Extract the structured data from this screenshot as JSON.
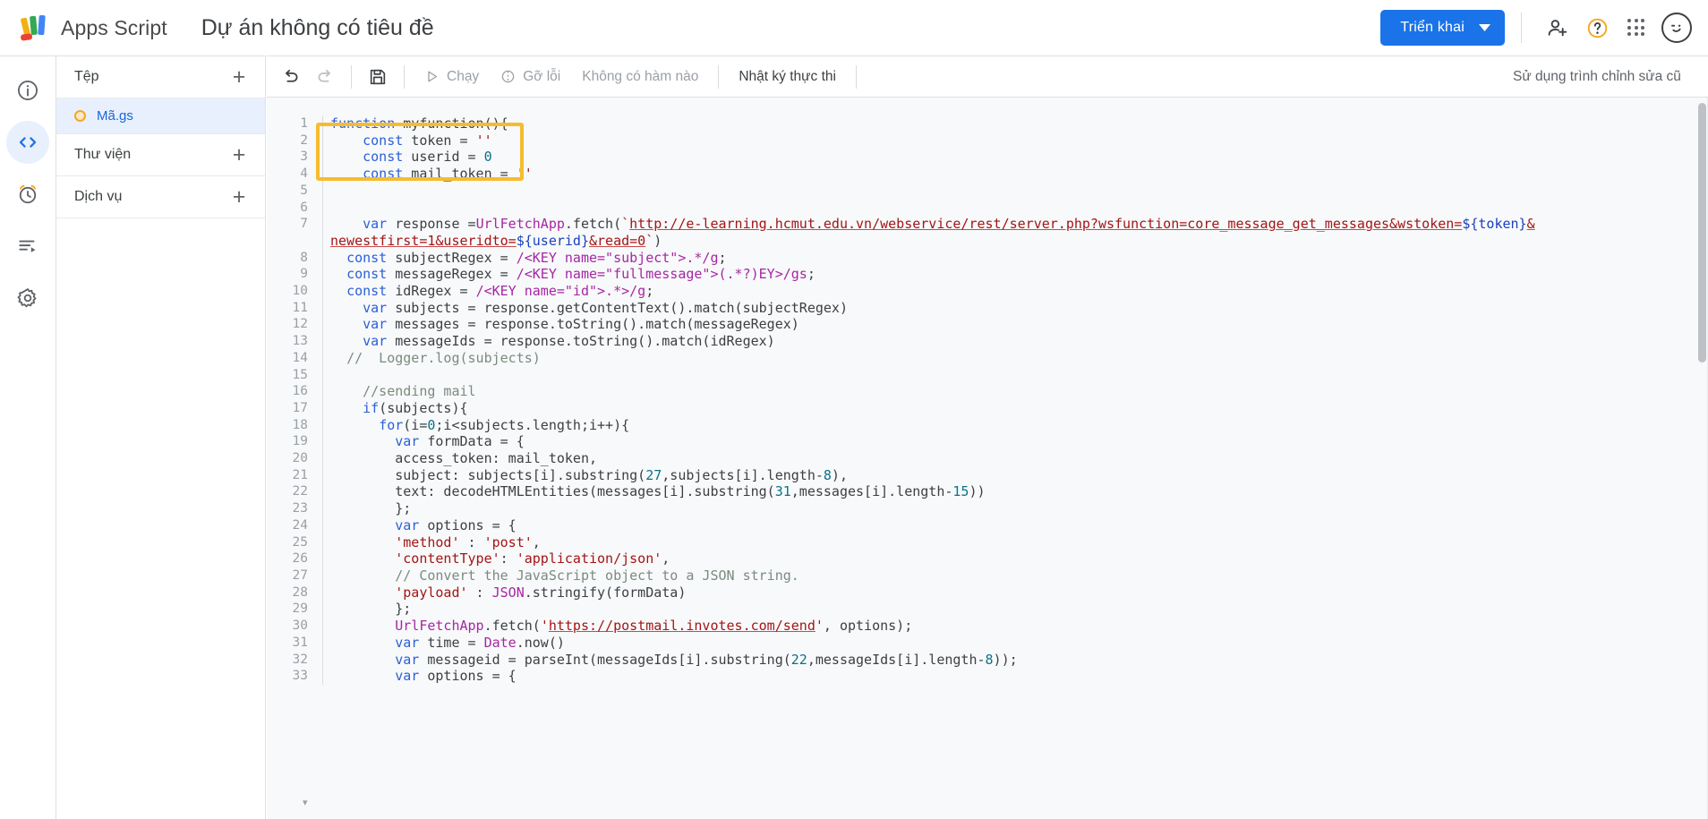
{
  "header": {
    "app_title": "Apps Script",
    "project_title": "Dự án không có tiêu đề",
    "deploy_label": "Triển khai",
    "icons": {
      "add_person": "add-person-icon",
      "help": "help-icon",
      "apps_grid": "apps-grid-icon",
      "avatar": "avatar-wink-icon"
    },
    "brand_color": "#1a73e8"
  },
  "rail": {
    "items": [
      {
        "name": "overview",
        "icon": "info-circle-icon",
        "active": false
      },
      {
        "name": "editor",
        "icon": "code-brackets-icon",
        "active": true
      },
      {
        "name": "triggers",
        "icon": "alarm-clock-icon",
        "active": false
      },
      {
        "name": "executions",
        "icon": "executions-list-icon",
        "active": false
      },
      {
        "name": "settings",
        "icon": "gear-icon",
        "active": false
      }
    ],
    "active_bg": "#e8f0fe"
  },
  "explorer": {
    "sections": [
      {
        "label": "Tệp",
        "add_icon": "plus-icon"
      },
      {
        "label": "Thư viện",
        "add_icon": "plus-icon"
      },
      {
        "label": "Dịch vụ",
        "add_icon": "plus-icon"
      }
    ],
    "file": {
      "label": "Mã.gs",
      "dot_color": "#f5a623",
      "selected": true
    }
  },
  "toolbar": {
    "undo_icon": "undo-icon",
    "redo_icon": "redo-icon",
    "save_icon": "save-icon",
    "run_label": "Chạy",
    "run_icon": "play-icon",
    "debug_label": "Gỡ lỗi",
    "debug_icon": "bug-icon",
    "function_select": "Không có hàm nào",
    "execution_log_label": "Nhật ký thực thi",
    "legacy_editor_label": "Sử dụng trình chỉnh sửa cũ"
  },
  "editor": {
    "highlight_box_color": "#f6bc2f",
    "highlight_lines": [
      2,
      3,
      4
    ],
    "lines": [
      {
        "n": "1",
        "tokens": [
          {
            "t": "function ",
            "c": "kw"
          },
          {
            "t": "myfunction(){",
            "c": ""
          }
        ]
      },
      {
        "n": "2",
        "tokens": [
          {
            "t": "    ",
            "c": ""
          },
          {
            "t": "const",
            "c": "kw"
          },
          {
            "t": " token = ",
            "c": ""
          },
          {
            "t": "''",
            "c": "str"
          }
        ]
      },
      {
        "n": "3",
        "tokens": [
          {
            "t": "    ",
            "c": ""
          },
          {
            "t": "const",
            "c": "kw"
          },
          {
            "t": " userid = ",
            "c": ""
          },
          {
            "t": "0",
            "c": "num"
          }
        ]
      },
      {
        "n": "4",
        "tokens": [
          {
            "t": "    ",
            "c": ""
          },
          {
            "t": "const",
            "c": "kw"
          },
          {
            "t": " mail_token = ",
            "c": ""
          },
          {
            "t": "''",
            "c": "str"
          }
        ]
      },
      {
        "n": "5",
        "tokens": [
          {
            "t": "",
            "c": ""
          }
        ]
      },
      {
        "n": "6",
        "tokens": [
          {
            "t": "",
            "c": ""
          }
        ]
      },
      {
        "n": "7",
        "tokens": [
          {
            "t": "    ",
            "c": ""
          },
          {
            "t": "var",
            "c": "kw"
          },
          {
            "t": " response =",
            "c": ""
          },
          {
            "t": "UrlFetchApp",
            "c": "cls"
          },
          {
            "t": ".fetch(",
            "c": ""
          },
          {
            "t": "`",
            "c": "str"
          },
          {
            "t": "http://e-learning.hcmut.edu.vn/webservice/rest/server.php?wsfunction=core_message_get_messages&wstoken=",
            "c": "urlstr"
          },
          {
            "t": "${token}",
            "c": "tpl"
          },
          {
            "t": "&",
            "c": "urlstr"
          }
        ]
      },
      {
        "n": "",
        "wrap": true,
        "tokens": [
          {
            "t": "newestfirst=1&useridto=",
            "c": "urlstr"
          },
          {
            "t": "${userid}",
            "c": "tpl"
          },
          {
            "t": "&read=0",
            "c": "urlstr"
          },
          {
            "t": "`",
            "c": "str"
          },
          {
            "t": ")",
            "c": ""
          }
        ]
      },
      {
        "n": "8",
        "tokens": [
          {
            "t": "  ",
            "c": ""
          },
          {
            "t": "const",
            "c": "kw"
          },
          {
            "t": " subjectRegex = ",
            "c": ""
          },
          {
            "t": "/<KEY name=\"subject\">.*/g",
            "c": "rgx"
          },
          {
            "t": ";",
            "c": ""
          }
        ]
      },
      {
        "n": "9",
        "tokens": [
          {
            "t": "  ",
            "c": ""
          },
          {
            "t": "const",
            "c": "kw"
          },
          {
            "t": " messageRegex = ",
            "c": ""
          },
          {
            "t": "/<KEY name=\"fullmessage\">(.*?)EY>/gs",
            "c": "rgx"
          },
          {
            "t": ";",
            "c": ""
          }
        ]
      },
      {
        "n": "10",
        "tokens": [
          {
            "t": "  ",
            "c": ""
          },
          {
            "t": "const",
            "c": "kw"
          },
          {
            "t": " idRegex = ",
            "c": ""
          },
          {
            "t": "/<KEY name=\"id\">.*>/g",
            "c": "rgx"
          },
          {
            "t": ";",
            "c": ""
          }
        ]
      },
      {
        "n": "11",
        "tokens": [
          {
            "t": "    ",
            "c": ""
          },
          {
            "t": "var",
            "c": "kw"
          },
          {
            "t": " subjects = response.getContentText().match(subjectRegex)",
            "c": ""
          }
        ]
      },
      {
        "n": "12",
        "tokens": [
          {
            "t": "    ",
            "c": ""
          },
          {
            "t": "var",
            "c": "kw"
          },
          {
            "t": " messages = response.toString().match(messageRegex)",
            "c": ""
          }
        ]
      },
      {
        "n": "13",
        "tokens": [
          {
            "t": "    ",
            "c": ""
          },
          {
            "t": "var",
            "c": "kw"
          },
          {
            "t": " messageIds = response.toString().match(idRegex)",
            "c": ""
          }
        ]
      },
      {
        "n": "14",
        "tokens": [
          {
            "t": "  ",
            "c": ""
          },
          {
            "t": "//  Logger.log(subjects)",
            "c": "com"
          }
        ]
      },
      {
        "n": "15",
        "tokens": [
          {
            "t": "",
            "c": ""
          }
        ]
      },
      {
        "n": "16",
        "tokens": [
          {
            "t": "    ",
            "c": ""
          },
          {
            "t": "//sending mail",
            "c": "com"
          }
        ]
      },
      {
        "n": "17",
        "tokens": [
          {
            "t": "    ",
            "c": ""
          },
          {
            "t": "if",
            "c": "kw"
          },
          {
            "t": "(subjects){",
            "c": ""
          }
        ]
      },
      {
        "n": "18",
        "tokens": [
          {
            "t": "      ",
            "c": ""
          },
          {
            "t": "for",
            "c": "kw"
          },
          {
            "t": "(i=",
            "c": ""
          },
          {
            "t": "0",
            "c": "num"
          },
          {
            "t": ";i<subjects.length;i++){",
            "c": ""
          }
        ]
      },
      {
        "n": "19",
        "tokens": [
          {
            "t": "        ",
            "c": ""
          },
          {
            "t": "var",
            "c": "kw"
          },
          {
            "t": " formData = {",
            "c": ""
          }
        ]
      },
      {
        "n": "20",
        "tokens": [
          {
            "t": "        access_token: mail_token,",
            "c": ""
          }
        ]
      },
      {
        "n": "21",
        "tokens": [
          {
            "t": "        subject: subjects[i].substring(",
            "c": ""
          },
          {
            "t": "27",
            "c": "num"
          },
          {
            "t": ",subjects[i].length-",
            "c": ""
          },
          {
            "t": "8",
            "c": "num"
          },
          {
            "t": "),",
            "c": ""
          }
        ]
      },
      {
        "n": "22",
        "tokens": [
          {
            "t": "        text: decodeHTMLEntities(messages[i].substring(",
            "c": ""
          },
          {
            "t": "31",
            "c": "num"
          },
          {
            "t": ",messages[i].length-",
            "c": ""
          },
          {
            "t": "15",
            "c": "num"
          },
          {
            "t": "))",
            "c": ""
          }
        ]
      },
      {
        "n": "23",
        "tokens": [
          {
            "t": "        };",
            "c": ""
          }
        ]
      },
      {
        "n": "24",
        "tokens": [
          {
            "t": "        ",
            "c": ""
          },
          {
            "t": "var",
            "c": "kw"
          },
          {
            "t": " options = {",
            "c": ""
          }
        ]
      },
      {
        "n": "25",
        "tokens": [
          {
            "t": "        ",
            "c": ""
          },
          {
            "t": "'method'",
            "c": "str"
          },
          {
            "t": " : ",
            "c": ""
          },
          {
            "t": "'post'",
            "c": "str"
          },
          {
            "t": ",",
            "c": ""
          }
        ]
      },
      {
        "n": "26",
        "tokens": [
          {
            "t": "        ",
            "c": ""
          },
          {
            "t": "'contentType'",
            "c": "str"
          },
          {
            "t": ": ",
            "c": ""
          },
          {
            "t": "'application/json'",
            "c": "str"
          },
          {
            "t": ",",
            "c": ""
          }
        ]
      },
      {
        "n": "27",
        "tokens": [
          {
            "t": "        ",
            "c": ""
          },
          {
            "t": "// Convert the JavaScript object to a JSON string.",
            "c": "com"
          }
        ]
      },
      {
        "n": "28",
        "tokens": [
          {
            "t": "        ",
            "c": ""
          },
          {
            "t": "'payload'",
            "c": "str"
          },
          {
            "t": " : ",
            "c": ""
          },
          {
            "t": "JSON",
            "c": "cls"
          },
          {
            "t": ".stringify(formData)",
            "c": ""
          }
        ]
      },
      {
        "n": "29",
        "tokens": [
          {
            "t": "        };",
            "c": ""
          }
        ]
      },
      {
        "n": "30",
        "tokens": [
          {
            "t": "        ",
            "c": ""
          },
          {
            "t": "UrlFetchApp",
            "c": "cls"
          },
          {
            "t": ".fetch(",
            "c": ""
          },
          {
            "t": "'",
            "c": "str"
          },
          {
            "t": "https://postmail.invotes.com/send",
            "c": "urlstr"
          },
          {
            "t": "'",
            "c": "str"
          },
          {
            "t": ", options);",
            "c": ""
          }
        ]
      },
      {
        "n": "31",
        "tokens": [
          {
            "t": "        ",
            "c": ""
          },
          {
            "t": "var",
            "c": "kw"
          },
          {
            "t": " time = ",
            "c": ""
          },
          {
            "t": "Date",
            "c": "cls"
          },
          {
            "t": ".now()",
            "c": ""
          }
        ]
      },
      {
        "n": "32",
        "tokens": [
          {
            "t": "        ",
            "c": ""
          },
          {
            "t": "var",
            "c": "kw"
          },
          {
            "t": " messageid = parseInt(messageIds[i].substring(",
            "c": ""
          },
          {
            "t": "22",
            "c": "num"
          },
          {
            "t": ",messageIds[i].length-",
            "c": ""
          },
          {
            "t": "8",
            "c": "num"
          },
          {
            "t": "));",
            "c": ""
          }
        ]
      },
      {
        "n": "33",
        "tokens": [
          {
            "t": "        ",
            "c": ""
          },
          {
            "t": "var",
            "c": "kw"
          },
          {
            "t": " options = {",
            "c": ""
          }
        ]
      }
    ]
  }
}
